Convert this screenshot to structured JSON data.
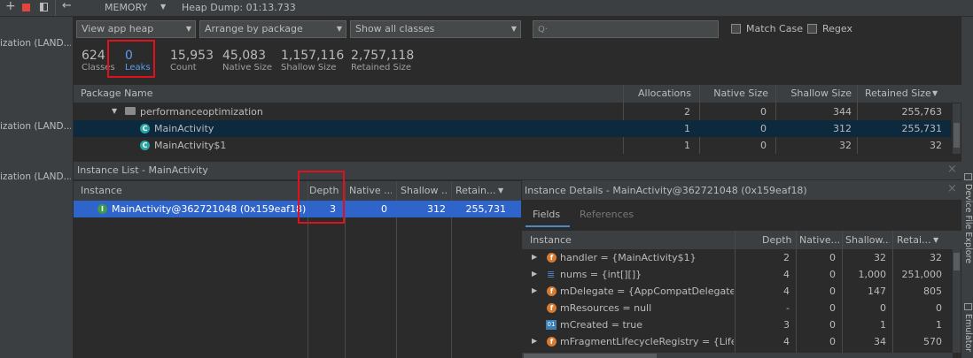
{
  "toolbar": {
    "add_icon": "plus-icon",
    "stop_icon": "stop-icon",
    "layout_icon": "layout-icon",
    "back_icon": "back-arrow-icon",
    "title": "MEMORY",
    "dump_label": "Heap Dump: 01:13.733"
  },
  "sidebar": {
    "items": [
      "ization (LAND...",
      "ization (LAND...",
      "ization (LAND..."
    ]
  },
  "filters": {
    "heap": "View app heap",
    "arrange": "Arrange by package",
    "classes": "Show all classes",
    "search_placeholder": "",
    "match_case": "Match Case",
    "regex": "Regex"
  },
  "stats": [
    {
      "value": "624",
      "label": "Classes"
    },
    {
      "value": "0",
      "label": "Leaks"
    },
    {
      "value": "15,953",
      "label": "Count"
    },
    {
      "value": "45,083",
      "label": "Native Size"
    },
    {
      "value": "1,157,116",
      "label": "Shallow Size"
    },
    {
      "value": "2,757,118",
      "label": "Retained Size"
    }
  ],
  "class_table": {
    "headers": [
      "Package Name",
      "Allocations",
      "Native Size",
      "Shallow Size",
      "Retained Size"
    ],
    "sort_indicator": "▼",
    "rows": [
      {
        "name": "performanceoptimization",
        "alloc": "2",
        "native": "0",
        "shallow": "344",
        "retained": "255,763",
        "kind": "package"
      },
      {
        "name": "MainActivity",
        "alloc": "1",
        "native": "0",
        "shallow": "312",
        "retained": "255,731",
        "kind": "class"
      },
      {
        "name": "MainActivity$1",
        "alloc": "1",
        "native": "0",
        "shallow": "32",
        "retained": "32",
        "kind": "class"
      }
    ]
  },
  "instance_list": {
    "title": "Instance List - MainActivity",
    "headers": [
      "Instance",
      "Depth",
      "Native ...",
      "Shallow ...",
      "Retain..."
    ],
    "rows": [
      {
        "name": "MainActivity@362721048 (0x159eaf18)",
        "depth": "3",
        "native": "0",
        "shallow": "312",
        "retained": "255,731"
      }
    ]
  },
  "instance_details": {
    "title": "Instance Details - MainActivity@362721048 (0x159eaf18)",
    "tabs": [
      "Fields",
      "References"
    ],
    "headers": [
      "Instance",
      "Depth",
      "Native...",
      "Shallow...",
      "Retai..."
    ],
    "rows": [
      {
        "name": "handler = {MainActivity$1}",
        "depth": "2",
        "native": "0",
        "shallow": "32",
        "retained": "32",
        "icon": "f",
        "expand": true
      },
      {
        "name": "nums = {int[][]}",
        "depth": "4",
        "native": "0",
        "shallow": "1,000",
        "retained": "251,000",
        "icon": "arr",
        "expand": true
      },
      {
        "name": "mDelegate = {AppCompatDelegateIm",
        "depth": "4",
        "native": "0",
        "shallow": "147",
        "retained": "805",
        "icon": "f",
        "expand": true
      },
      {
        "name": "mResources = null",
        "depth": "-",
        "native": "0",
        "shallow": "0",
        "retained": "0",
        "icon": "f",
        "expand": false
      },
      {
        "name": "mCreated = true",
        "depth": "3",
        "native": "0",
        "shallow": "1",
        "retained": "1",
        "icon": "01",
        "expand": false
      },
      {
        "name": "mFragmentLifecycleRegistry = {Lifecyc",
        "depth": "4",
        "native": "0",
        "shallow": "34",
        "retained": "570",
        "icon": "f",
        "expand": true
      }
    ]
  },
  "right_rail": [
    "Device File Explorer",
    "Emulator"
  ]
}
